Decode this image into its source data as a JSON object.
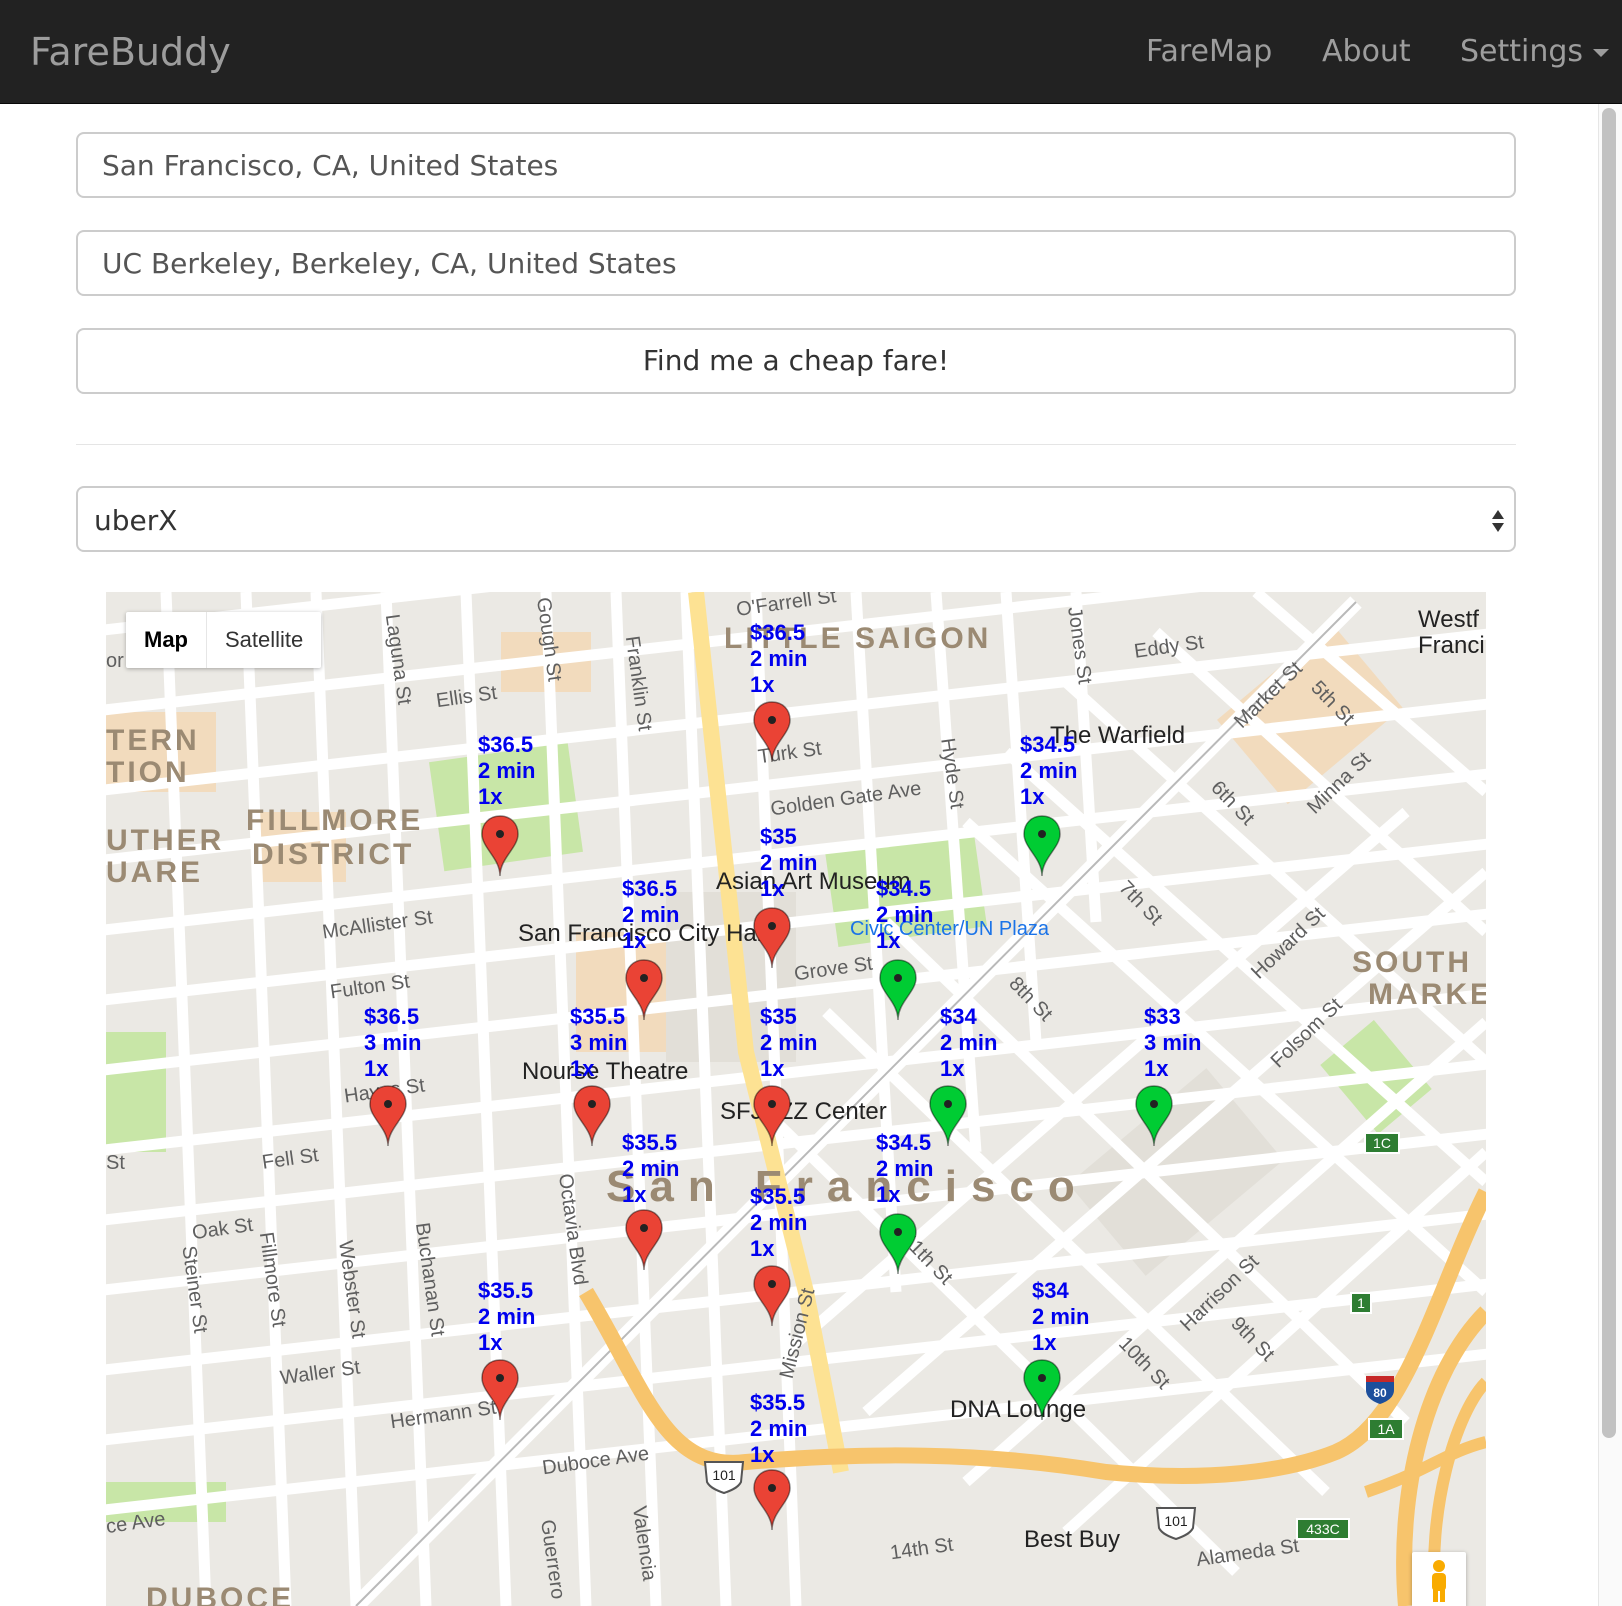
{
  "navbar": {
    "brand": "FareBuddy",
    "links": [
      "FareMap",
      "About",
      "Settings"
    ]
  },
  "form": {
    "origin_value": "San Francisco, CA, United States",
    "destination_value": "UC Berkeley, Berkeley, CA, United States",
    "submit_label": "Find me a cheap fare!",
    "product_selected": "uberX"
  },
  "map": {
    "type_buttons": [
      "Map",
      "Satellite"
    ],
    "districts": [
      "LITTLE SAIGON",
      "FILLMORE",
      "DISTRICT",
      "TERN",
      "TION",
      "UTHER",
      "UARE",
      "SOUTH",
      "MARKE",
      "San Francisco",
      "DUBOCE"
    ],
    "pois": [
      "The Warfield",
      "Asian Art Museum",
      "San Francisco City Hall",
      "Civic Center/UN Plaza",
      "Nourse Theatre",
      "SFJAZZ Center",
      "DNA Lounge",
      "Best Buy",
      "Westf",
      "Franci"
    ],
    "streets": [
      "O'Farrell St",
      "Eddy St",
      "Ellis St",
      "Turk St",
      "Golden Gate Ave",
      "McAllister St",
      "Fulton St",
      "Grove St",
      "Hayes St",
      "Fell St",
      "Oak St",
      "Waller St",
      "Hermann St",
      "Duboce Ave",
      "14th St",
      "Alameda St",
      "Market St",
      "Mission St",
      "Howard St",
      "Folsom St",
      "Harrison St",
      "Minna St",
      "5th St",
      "6th St",
      "7th St",
      "8th St",
      "9th St",
      "10th St",
      "11th St",
      "Gough St",
      "Franklin St",
      "Laguna St",
      "Webster St",
      "Fillmore St",
      "Steiner St",
      "Buchanan St",
      "Octavia Blvd",
      "Hyde St",
      "Jones St",
      "Valencia",
      "Guerrero",
      "St",
      "ce Ave",
      "or"
    ],
    "shields": [
      "101",
      "101",
      "80",
      "1C",
      "1",
      "1A",
      "433C"
    ],
    "fares": [
      {
        "price": "$36.5",
        "eta": "2 min",
        "surge": "1x",
        "color": "red"
      },
      {
        "price": "$36.5",
        "eta": "2 min",
        "surge": "1x",
        "color": "red"
      },
      {
        "price": "$34.5",
        "eta": "2 min",
        "surge": "1x",
        "color": "green"
      },
      {
        "price": "$35",
        "eta": "2 min",
        "surge": "1x",
        "color": "red"
      },
      {
        "price": "$36.5",
        "eta": "2 min",
        "surge": "1x",
        "color": "red"
      },
      {
        "price": "$34.5",
        "eta": "2 min",
        "surge": "1x",
        "color": "green"
      },
      {
        "price": "$36.5",
        "eta": "3 min",
        "surge": "1x",
        "color": "red"
      },
      {
        "price": "$35.5",
        "eta": "3 min",
        "surge": "1x",
        "color": "red"
      },
      {
        "price": "$35",
        "eta": "2 min",
        "surge": "1x",
        "color": "red"
      },
      {
        "price": "$34",
        "eta": "2 min",
        "surge": "1x",
        "color": "green"
      },
      {
        "price": "$33",
        "eta": "3 min",
        "surge": "1x",
        "color": "green"
      },
      {
        "price": "$35.5",
        "eta": "2 min",
        "surge": "1x",
        "color": "red"
      },
      {
        "price": "$34.5",
        "eta": "2 min",
        "surge": "1x",
        "color": "green"
      },
      {
        "price": "$35.5",
        "eta": "2 min",
        "surge": "1x",
        "color": "red"
      },
      {
        "price": "$35.5",
        "eta": "2 min",
        "surge": "1x",
        "color": "red"
      },
      {
        "price": "$34",
        "eta": "2 min",
        "surge": "1x",
        "color": "green"
      },
      {
        "price": "$35.5",
        "eta": "2 min",
        "surge": "1x",
        "color": "red"
      }
    ],
    "colors": {
      "red_pin": "#ea4335",
      "green_pin": "#00cc33",
      "fare_text": "#0000ee",
      "highway": "#f7c46c",
      "park": "#c8e6a7"
    }
  }
}
